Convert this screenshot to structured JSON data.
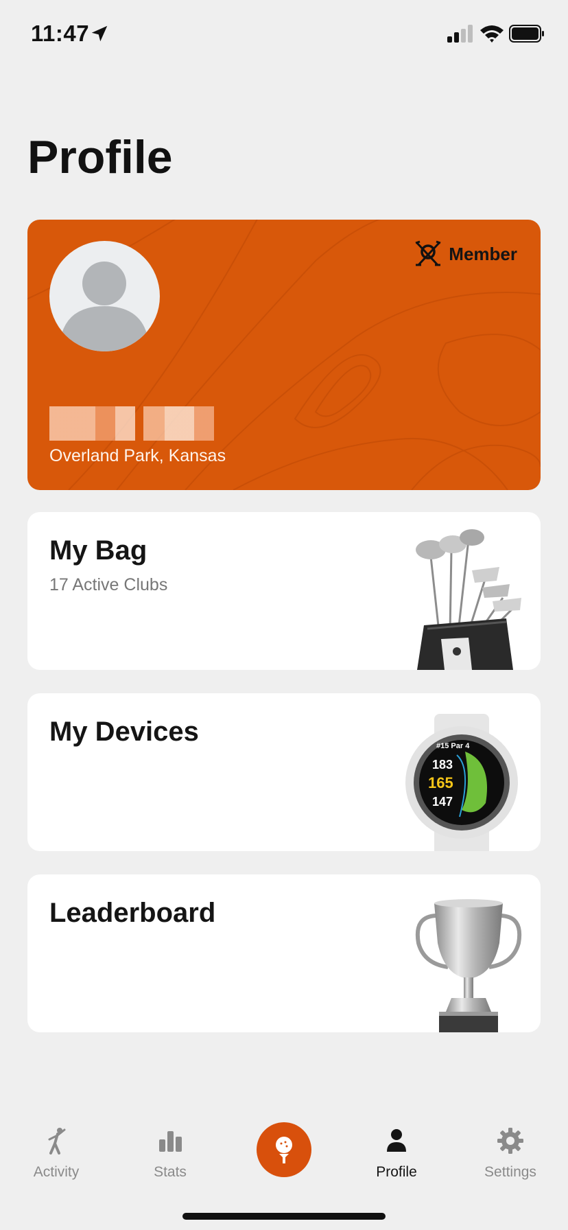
{
  "status_bar": {
    "time": "11:47"
  },
  "page": {
    "title": "Profile"
  },
  "profile_card": {
    "badge_label": "Member",
    "location": "Overland Park, Kansas",
    "accent_color": "#d8580a"
  },
  "cards": [
    {
      "title": "My Bag",
      "subtitle": "17 Active Clubs",
      "art_icon": "golf-bag-icon"
    },
    {
      "title": "My Devices",
      "subtitle": "",
      "art_icon": "smartwatch-icon",
      "watch_screen": {
        "hole": "#15 Par 4",
        "back": "183",
        "middle": "165",
        "front": "147"
      }
    },
    {
      "title": "Leaderboard",
      "subtitle": "",
      "art_icon": "trophy-icon"
    }
  ],
  "tabs": [
    {
      "label": "Activity",
      "icon": "golfer-icon",
      "active": false
    },
    {
      "label": "Stats",
      "icon": "bar-chart-icon",
      "active": false
    },
    {
      "label": "",
      "icon": "golf-ball-tee-icon",
      "active": false
    },
    {
      "label": "Profile",
      "icon": "person-icon",
      "active": true
    },
    {
      "label": "Settings",
      "icon": "gear-icon",
      "active": false
    }
  ]
}
